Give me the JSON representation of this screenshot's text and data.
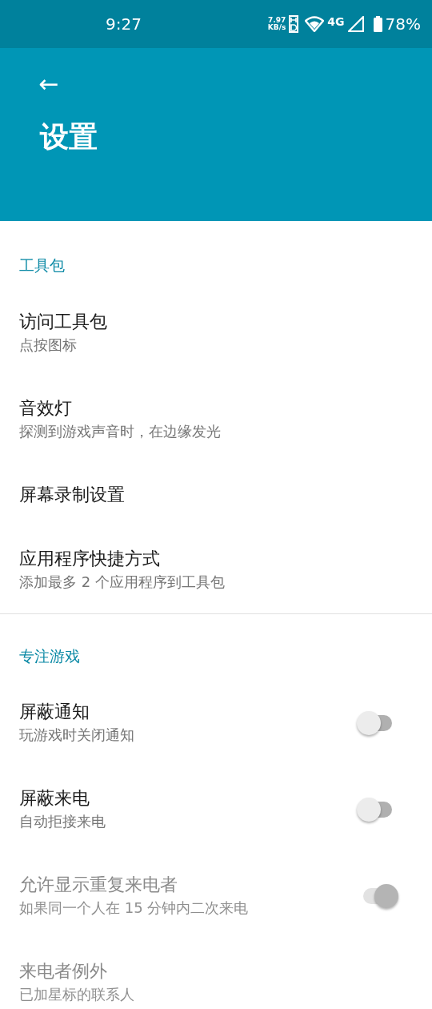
{
  "status_bar": {
    "time": "9:27",
    "speed_value": "7.97",
    "speed_unit": "KB/s",
    "network": "4G",
    "battery": "78%"
  },
  "header": {
    "back": "←",
    "title": "设置"
  },
  "sections": [
    {
      "title": "工具包",
      "items": [
        {
          "kind": "text",
          "title": "访问工具包",
          "subtitle": "点按图标",
          "disabled": false
        },
        {
          "kind": "text",
          "title": "音效灯",
          "subtitle": "探测到游戏声音时，在边缘发光",
          "disabled": false
        },
        {
          "kind": "text",
          "title": "屏幕录制设置",
          "disabled": false
        },
        {
          "kind": "text",
          "title": "应用程序快捷方式",
          "subtitle": "添加最多 2 个应用程序到工具包",
          "disabled": false
        }
      ]
    },
    {
      "title": "专注游戏",
      "items": [
        {
          "kind": "toggle",
          "title": "屏蔽通知",
          "subtitle": "玩游戏时关闭通知",
          "on": false,
          "disabled": false
        },
        {
          "kind": "toggle",
          "title": "屏蔽来电",
          "subtitle": "自动拒接来电",
          "on": false,
          "disabled": false
        },
        {
          "kind": "toggle",
          "title": "允许显示重复来电者",
          "subtitle": "如果同一个人在 15 分钟内二次来电",
          "on": true,
          "disabled": true
        },
        {
          "kind": "text",
          "title": "来电者例外",
          "subtitle": "已加星标的联系人",
          "disabled": true
        }
      ]
    }
  ]
}
